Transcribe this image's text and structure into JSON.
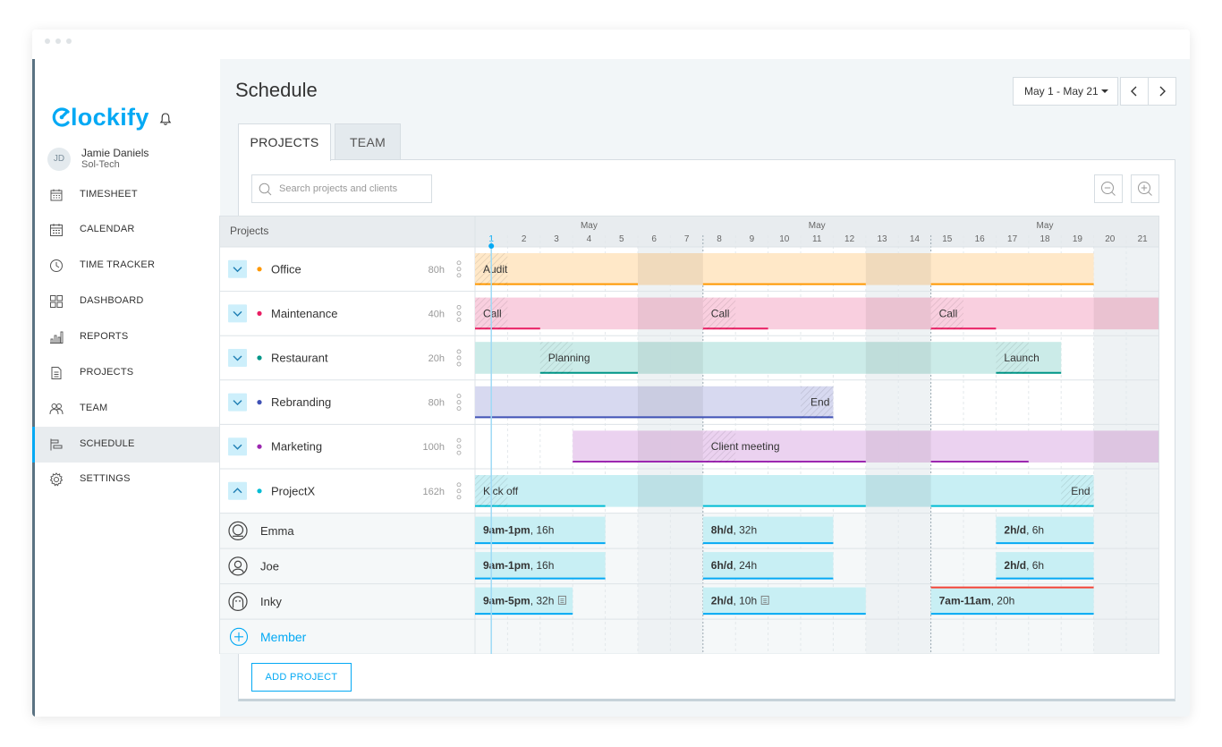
{
  "app": {
    "logo": "Clockify"
  },
  "user": {
    "initials": "JD",
    "name": "Jamie Daniels",
    "org": "Sol-Tech"
  },
  "nav": [
    {
      "id": "timesheet",
      "label": "TIMESHEET",
      "icon": "timesheet-icon"
    },
    {
      "id": "calendar",
      "label": "CALENDAR",
      "icon": "calendar-icon"
    },
    {
      "id": "time-tracker",
      "label": "TIME TRACKER",
      "icon": "clock-icon"
    },
    {
      "id": "dashboard",
      "label": "DASHBOARD",
      "icon": "dashboard-icon"
    },
    {
      "id": "reports",
      "label": "REPORTS",
      "icon": "reports-icon"
    },
    {
      "id": "projects",
      "label": "PROJECTS",
      "icon": "document-icon"
    },
    {
      "id": "team",
      "label": "TEAM",
      "icon": "team-icon"
    },
    {
      "id": "schedule",
      "label": "SCHEDULE",
      "icon": "schedule-icon",
      "active": true
    },
    {
      "id": "settings",
      "label": "SETTINGS",
      "icon": "gear-icon"
    }
  ],
  "page": {
    "title": "Schedule",
    "date_range": "May 1 - May 21",
    "tabs": {
      "projects": "PROJECTS",
      "team": "TEAM"
    },
    "search_placeholder": "Search projects and clients",
    "add_project": "ADD PROJECT"
  },
  "grid": {
    "header_label": "Projects",
    "month_labels": [
      {
        "text": "May",
        "day": 4
      },
      {
        "text": "May",
        "day": 11
      },
      {
        "text": "May",
        "day": 18
      }
    ],
    "days": [
      "1",
      "2",
      "3",
      "4",
      "5",
      "6",
      "7",
      "8",
      "9",
      "10",
      "11",
      "12",
      "13",
      "14",
      "15",
      "16",
      "17",
      "18",
      "19",
      "20",
      "21"
    ],
    "weekend_days": [
      6,
      7,
      13,
      14,
      20,
      21
    ],
    "today": 1,
    "projects": [
      {
        "name": "Office",
        "hours": "80h",
        "color": "#ff9800",
        "bar": "#ffe8c8",
        "expanded": false,
        "bars": [
          {
            "start": 1,
            "end": 20,
            "label": "Audit",
            "under": [
              [
                1,
                5
              ],
              [
                8,
                12
              ],
              [
                15,
                19
              ]
            ]
          }
        ]
      },
      {
        "name": "Maintenance",
        "hours": "40h",
        "color": "#e91e63",
        "bar": "#f9cfdf",
        "expanded": false,
        "bars": [
          {
            "start": 1,
            "end": 22,
            "label": "Call",
            "labelDay": 1,
            "under": [
              [
                1,
                2
              ],
              [
                8,
                9
              ],
              [
                15,
                16
              ]
            ],
            "extraLabels": [
              {
                "label": "Call",
                "day": 8
              },
              {
                "label": "Call",
                "day": 15
              }
            ]
          }
        ]
      },
      {
        "name": "Restaurant",
        "hours": "20h",
        "color": "#009688",
        "bar": "#cbebe8",
        "expanded": false,
        "bars": [
          {
            "start": 1,
            "end": 19,
            "label": "Planning",
            "labelDay": 3,
            "under": [
              [
                3,
                5
              ],
              [
                17,
                18
              ]
            ],
            "extraLabels": [
              {
                "label": "Launch",
                "day": 17
              }
            ]
          }
        ]
      },
      {
        "name": "Rebranding",
        "hours": "80h",
        "color": "#3f51b5",
        "bar": "#d7d9f0",
        "expanded": false,
        "bars": [
          {
            "start": 1,
            "end": 12,
            "label": "End",
            "labelDay": 11,
            "labelRight": true,
            "under": [
              [
                1,
                11
              ]
            ]
          }
        ]
      },
      {
        "name": "Marketing",
        "hours": "100h",
        "color": "#9c27b0",
        "bar": "#ebd2f0",
        "expanded": false,
        "bars": [
          {
            "start": 4,
            "end": 22,
            "label": "Client meeting",
            "labelDay": 8,
            "under": [
              [
                4,
                12
              ],
              [
                15,
                17
              ]
            ]
          }
        ]
      },
      {
        "name": "ProjectX",
        "hours": "162h",
        "color": "#00bcd4",
        "bar": "#c8eff4",
        "expanded": true,
        "bars": [
          {
            "start": 1,
            "end": 20,
            "label": "Kick off",
            "labelDay": 1,
            "under": [
              [
                1,
                4
              ],
              [
                8,
                12
              ],
              [
                15,
                19
              ]
            ],
            "extraLabels": [
              {
                "label": "End",
                "day": 19,
                "right": true
              }
            ]
          }
        ]
      }
    ],
    "members": [
      {
        "name": "Emma",
        "avatar": "emma-avatar-icon",
        "assignments": [
          {
            "start": 1,
            "end": 5,
            "bold": "9am-1pm",
            "rest": ", 16h"
          },
          {
            "start": 8,
            "end": 12,
            "bold": "8h/d",
            "rest": ", 32h"
          },
          {
            "start": 17,
            "end": 20,
            "bold": "2h/d",
            "rest": ", 6h"
          }
        ]
      },
      {
        "name": "Joe",
        "avatar": "joe-avatar-icon",
        "assignments": [
          {
            "start": 1,
            "end": 5,
            "bold": "9am-1pm",
            "rest": ", 16h"
          },
          {
            "start": 8,
            "end": 12,
            "bold": "6h/d",
            "rest": ", 24h"
          },
          {
            "start": 17,
            "end": 20,
            "bold": "2h/d",
            "rest": ", 6h"
          }
        ]
      },
      {
        "name": "Inky",
        "avatar": "inky-avatar-icon",
        "assignments": [
          {
            "start": 1,
            "end": 4,
            "bold": "9am-5pm",
            "rest": ", 32h",
            "note": true
          },
          {
            "start": 8,
            "end": 13,
            "bold": "2h/d",
            "rest": ", 10h",
            "note": true
          },
          {
            "start": 15,
            "end": 20,
            "bold": "7am-11am",
            "rest": ", 20h",
            "overload": true
          }
        ]
      }
    ],
    "add_member": "Member"
  },
  "colors": {
    "accent": "#03a9f4",
    "member_bar": "#c8eff4",
    "member_line": "#03a9f4",
    "overload": "#f44336"
  }
}
